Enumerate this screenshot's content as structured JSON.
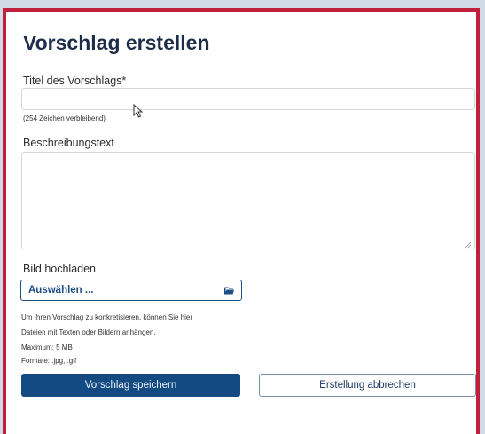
{
  "form": {
    "title": "Vorschlag erstellen",
    "title_field": {
      "label": "Titel des Vorschlags*",
      "value": "",
      "counter": "(254 Zeichen verbleibend)"
    },
    "description_field": {
      "label": "Beschreibungstext",
      "value": ""
    },
    "upload": {
      "label": "Bild hochladen",
      "select_label": "Auswählen ...",
      "icon": "folder-icon",
      "info_lines": [
        "Um Ihren Vorschlag zu konkretisieren, können Sie hier",
        "Dateien mit Texten oder Bildern anhängen.",
        "Maximum: 5 MB"
      ],
      "formats": "Formate: .jpg, .gif"
    },
    "buttons": {
      "save": "Vorschlag speichern",
      "cancel": "Erstellung abbrechen"
    }
  },
  "colors": {
    "frame_border": "#c0203a",
    "primary": "#134a82",
    "background": "#cfdbe6"
  }
}
